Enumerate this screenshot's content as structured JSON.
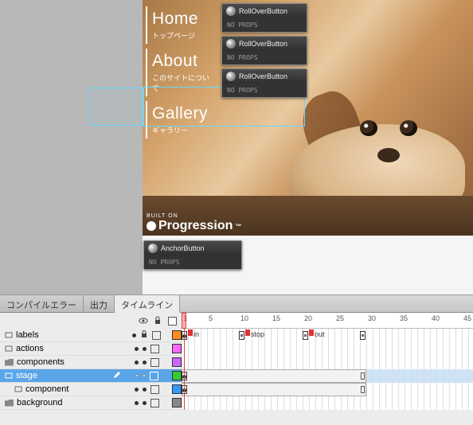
{
  "nav": [
    {
      "title": "Home",
      "sub": "トップページ"
    },
    {
      "title": "About",
      "sub": "このサイトについて"
    },
    {
      "title": "Gallery",
      "sub": "ギャラリー"
    }
  ],
  "components": {
    "rollover": "RollOverButton",
    "anchor": "AnchorButton",
    "noprops": "NO PROPS"
  },
  "logo": {
    "built": "BUILT ON",
    "name": "Progression"
  },
  "tabs": {
    "compile": "コンパイルエラー",
    "output": "出力",
    "timeline": "タイムライン"
  },
  "ruler": {
    "marks": [
      "1",
      "5",
      "10",
      "15",
      "20",
      "25",
      "30",
      "35",
      "40",
      "45"
    ]
  },
  "frameLabels": {
    "in": "in",
    "stop": "stop",
    "out": "out"
  },
  "layers": [
    {
      "name": "labels",
      "color": "#ff8c1a",
      "locked": true,
      "type": "normal"
    },
    {
      "name": "actions",
      "color": "#ff66ff",
      "locked": false,
      "type": "normal"
    },
    {
      "name": "components",
      "color": "#cc66ff",
      "locked": false,
      "type": "folder"
    },
    {
      "name": "stage",
      "color": "#33cc33",
      "locked": false,
      "type": "normal",
      "selected": true
    },
    {
      "name": "component",
      "color": "#3399ff",
      "locked": false,
      "type": "normal"
    },
    {
      "name": "background",
      "color": "#888888",
      "locked": false,
      "type": "folder"
    }
  ]
}
